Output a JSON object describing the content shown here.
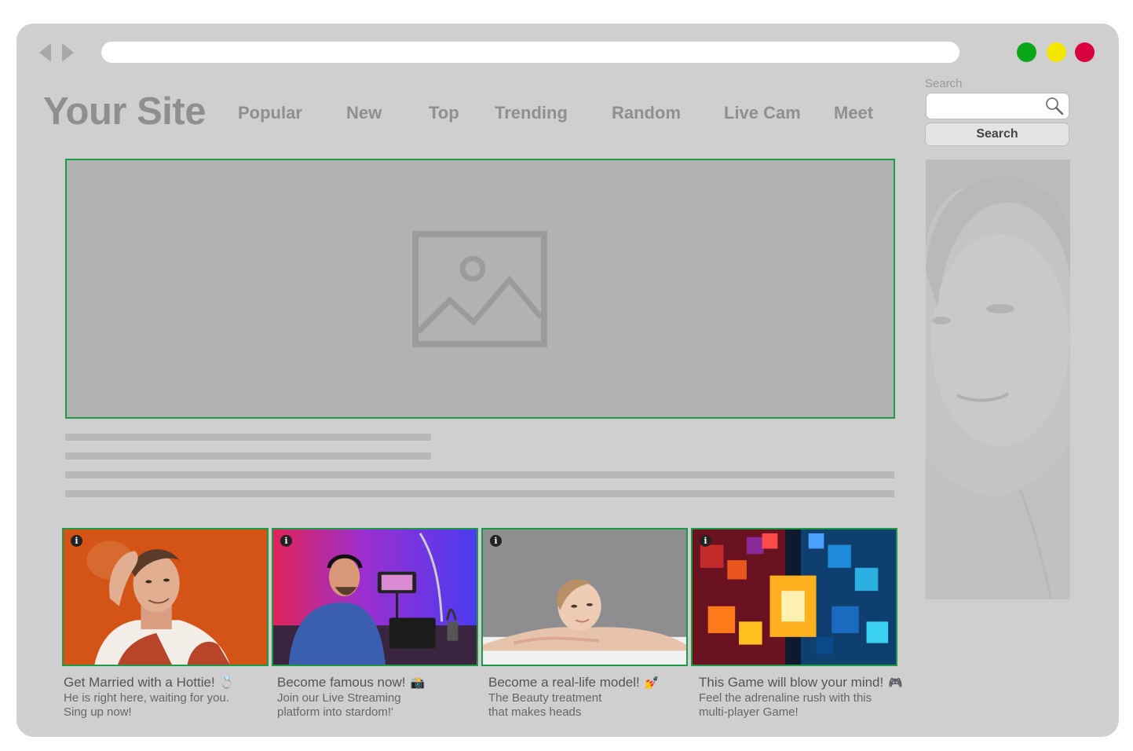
{
  "browser": {
    "url": ""
  },
  "header": {
    "logo": "Your Site",
    "menu": [
      "Popular",
      "New",
      "Top",
      "Trending",
      "Random",
      "Live Cam",
      "Meet"
    ]
  },
  "search": {
    "label": "Search",
    "value": "",
    "button": "Search"
  },
  "colors": {
    "frame": "#cfcfcf",
    "accent_border": "#1e9a44",
    "close": "#d8003f",
    "minimize": "#f5e800",
    "maximize": "#0aa61a"
  },
  "cards": [
    {
      "title": "Get Married with a Hottie!",
      "icon": "ring-icon",
      "desc1": "He is right here, waiting for you.",
      "desc2": "Sing up now!",
      "info": "i"
    },
    {
      "title": "Become famous now!",
      "icon": "camera-icon",
      "desc1": "Join our Live Streaming",
      "desc2": "platform into stardom!'",
      "info": "i"
    },
    {
      "title": "Become a real-life model!",
      "icon": "nail-polish-icon",
      "desc1": "The Beauty treatment",
      "desc2": "that makes heads",
      "info": "i"
    },
    {
      "title": "This Game will blow your mind!",
      "icon": "gamepad-icon",
      "desc1": "Feel the adrenaline rush with this",
      "desc2": "multi-player Game!",
      "info": "i"
    }
  ]
}
